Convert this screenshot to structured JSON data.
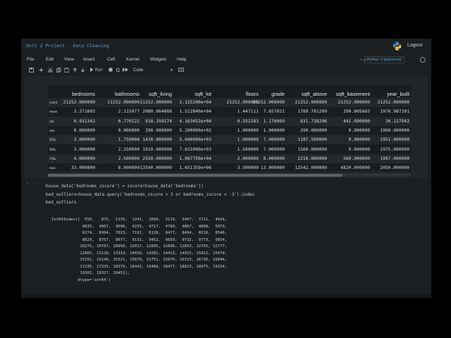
{
  "header": {
    "notebook_title": "Unit 2 Project - Data Cleaning",
    "logout": "Logout"
  },
  "menu": [
    "File",
    "Edit",
    "View",
    "Insert",
    "Cell",
    "Kernel",
    "Widgets",
    "Help"
  ],
  "kernel": {
    "trusted": "Trusted",
    "name": "Python 3 (ipykernel)"
  },
  "toolbar": {
    "run_label": "Run",
    "cell_type": "Code"
  },
  "describe_table": {
    "columns": [
      "bedrooms",
      "bathrooms",
      "sqft_living",
      "sqft_lot",
      "floors",
      "grade",
      "sqft_above",
      "sqft_basement",
      "year_built"
    ],
    "rows": [
      {
        "index": "count",
        "values": [
          "21252.000000",
          "21252.000000",
          "21252.000000",
          "2.125200e+04",
          "21252.000000",
          "21252.000000",
          "21252.000000",
          "21252.000000",
          "21252.000000"
        ]
      },
      {
        "index": "mean",
        "values": [
          "3.371603",
          "2.115977",
          "2080.064088",
          "1.512840e+04",
          "1.447111",
          "7.657021",
          "1789.701299",
          "290.605665",
          "1970.987201"
        ]
      },
      {
        "index": "std",
        "values": [
          "0.931342",
          "0.770122",
          "918.359174",
          "4.163452e+04",
          "0.552183",
          "1.176060",
          "831.738296",
          "441.990990",
          "30.127943"
        ]
      },
      {
        "index": "min",
        "values": [
          "0.000000",
          "0.000000",
          "290.000000",
          "5.200000e+02",
          "1.000000",
          "1.000000",
          "290.000000",
          "0.000000",
          "1900.000000"
        ]
      },
      {
        "index": "25%",
        "values": [
          "3.000000",
          "1.750000",
          "1430.000000",
          "5.040000e+03",
          "1.000000",
          "7.000000",
          "1197.500000",
          "0.000000",
          "1951.000000"
        ]
      },
      {
        "index": "50%",
        "values": [
          "3.000000",
          "2.250000",
          "1910.000000",
          "7.615000e+03",
          "1.500000",
          "7.000000",
          "1560.000000",
          "0.000000",
          "1975.000000"
        ]
      },
      {
        "index": "75%",
        "values": [
          "4.000000",
          "2.500000",
          "2550.000000",
          "1.067750e+04",
          "2.000000",
          "8.000000",
          "2210.000000",
          "560.000000",
          "1997.000000"
        ]
      },
      {
        "index": "max",
        "values": [
          "33.000000",
          "8.000000",
          "13540.000000",
          "1.651359e+06",
          "3.500000",
          "13.000000",
          "12542.000000",
          "4820.000000",
          "2050.000000"
        ]
      }
    ]
  },
  "cell2": {
    "prompt": "In [ ]:",
    "code": [
      "house_data['bedrooms_zscore'] = zscore(house_data['bedrooms'])",
      "bed_outliers=house_data.query('bedrooms_zscore > 3 or bedrooms_zscore < -3').index",
      "bed_outliers"
    ],
    "output": [
      "Int64Index([  556,   875,  1135,  1241,  1660,  3119,  3467,  3721,  4024,",
      "             4035,  4067,  4096,  4235,  4717,  4760,  4867,  4868,  5079,",
      "             6174,  6994,  7023,  7191,  8120,  8477,  8494,  8516,  8546,",
      "             8629,  8757,  9077,  9132,  9452,  9659,  9732,  9773,  9854,",
      "            10275, 10767, 10958, 12017, 12605, 12606, 12653, 12765, 12777,",
      "            12865, 13120, 13314, 14030, 14201, 14423, 14915, 15022, 15070,",
      "            15151, 15246, 15521, 15670, 15751, 15870, 16313, 16736, 16844,",
      "            17235, 17335, 18379, 18443, 18468, 18477, 18823, 18975, 19254,",
      "            19302, 19327, 19452],",
      "           dtype='int64')"
    ]
  },
  "colors": {
    "background": "#000000",
    "notebook_bg": "#1c1f22",
    "title_blue": "#5aa7d8",
    "text": "#c9cdd1"
  },
  "icons": [
    "python-logo-icon",
    "save-icon",
    "add-cell-icon",
    "cut-icon",
    "copy-icon",
    "paste-icon",
    "move-up-icon",
    "move-down-icon",
    "run-icon",
    "stop-icon",
    "restart-icon",
    "fast-forward-icon",
    "command-palette-icon"
  ]
}
